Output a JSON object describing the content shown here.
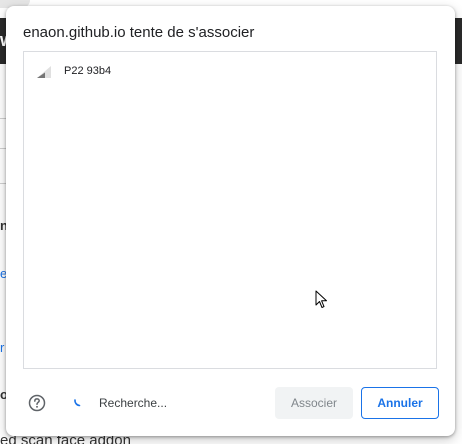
{
  "dialog": {
    "title": "enaon.github.io tente de s'associer",
    "devices": [
      {
        "name": "P22 93b4",
        "icon": "signal-strength-icon"
      }
    ],
    "search_status": "Recherche...",
    "associate_label": "Associer",
    "cancel_label": "Annuler"
  },
  "background": {
    "topbar_char": "w",
    "fragments": [
      "n",
      "e",
      "r",
      "o"
    ],
    "bottom_text": "ed scan face addon"
  },
  "colors": {
    "accent": "#1a73e8",
    "dialog_bg": "#ffffff",
    "disabled_button_bg": "#f1f3f4",
    "topbar_bg": "#2b2b2b"
  }
}
